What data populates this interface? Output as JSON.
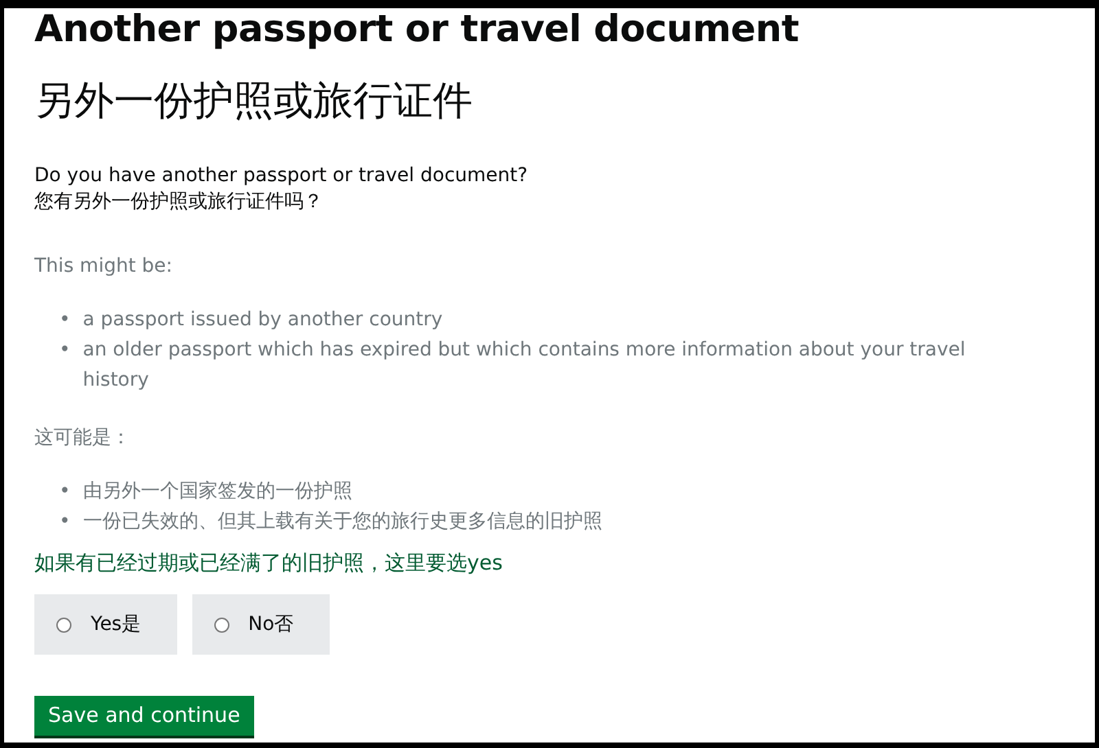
{
  "heading": "Another passport or travel document",
  "heading_zh": "另外一份护照或旅行证件",
  "question": "Do you have another passport or travel document?",
  "question_zh": "您有另外一份护照或旅行证件吗？",
  "hint_intro": "This might be:",
  "hint_items": [
    {
      "bullet": "•",
      "text": "a passport issued by another country"
    },
    {
      "bullet": "•",
      "text": "an older passport which has expired but which contains more information about your travel history"
    }
  ],
  "hint_intro_zh": "这可能是：",
  "hint_items_zh": [
    {
      "bullet": "•",
      "text": "由另外一个国家签发的一份护照"
    },
    {
      "bullet": "•",
      "text": "一份已失效的、但其上载有关于您的旅行史更多信息的旧护照"
    }
  ],
  "note": "如果有已经过期或已经满了的旧护照，这里要选yes",
  "options": [
    {
      "label": "Yes是",
      "selected": false
    },
    {
      "label": "No否",
      "selected": false
    }
  ],
  "button": "Save and continue"
}
